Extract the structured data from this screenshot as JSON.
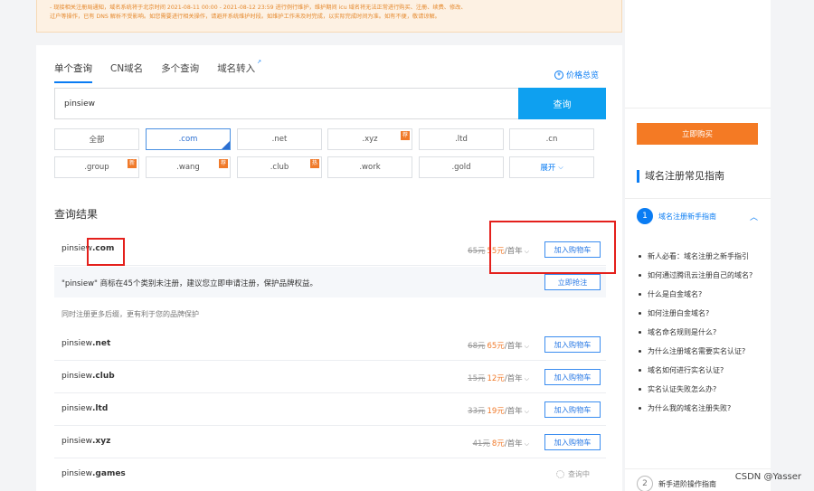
{
  "notice": {
    "line1": "- 现接相关注册局通知，域名系统将于北京时间 2021-08-11 00:00 - 2021-08-12 23:59 进行例行维护，维护期间 icu 域名将无法正常进行购买、注册、续费、修改、",
    "line2": "过户等操作，已有 DNS 解析不受影响。如您需要进行相关操作，请避开系统维护时段。如维护工作未及时完成，以实际完成时间为准。如有不便，敬请谅解。"
  },
  "tabs": [
    {
      "label": "单个查询"
    },
    {
      "label": "CN域名"
    },
    {
      "label": "多个查询"
    },
    {
      "label": "域名转入"
    }
  ],
  "price_overview": "价格总览",
  "search": {
    "value": "pinsiew",
    "button": "查询"
  },
  "tlds": [
    {
      "label": "全部"
    },
    {
      "label": ".com"
    },
    {
      "label": ".net"
    },
    {
      "label": ".xyz",
      "badge": "荐"
    },
    {
      "label": ".ltd"
    },
    {
      "label": ".cn"
    },
    {
      "label": ".group",
      "badge": "新"
    },
    {
      "label": ".wang",
      "badge": "荐"
    },
    {
      "label": ".club",
      "badge": "热"
    },
    {
      "label": ".work"
    },
    {
      "label": ".gold"
    },
    {
      "label": "展开"
    }
  ],
  "results_title": "查询结果",
  "results": [
    {
      "name": "pinsiew",
      "tld": ".com",
      "old_price": "65元",
      "new_price": "55元",
      "unit": "/首年",
      "action": "加入购物车"
    },
    {
      "name": "pinsiew",
      "tld": ".net",
      "old_price": "68元",
      "new_price": "65元",
      "unit": "/首年",
      "action": "加入购物车"
    },
    {
      "name": "pinsiew",
      "tld": ".club",
      "old_price": "15元",
      "new_price": "12元",
      "unit": "/首年",
      "action": "加入购物车"
    },
    {
      "name": "pinsiew",
      "tld": ".ltd",
      "old_price": "33元",
      "new_price": "19元",
      "unit": "/首年",
      "action": "加入购物车"
    },
    {
      "name": "pinsiew",
      "tld": ".xyz",
      "old_price": "41元",
      "new_price": "8元",
      "unit": "/首年",
      "action": "加入购物车"
    },
    {
      "name": "pinsiew",
      "tld": ".games",
      "status": "查询中"
    }
  ],
  "trademark": {
    "text": "\"pinsiew\" 商标在45个类别未注册，建议您立即申请注册，保护品牌权益。",
    "button": "立即抢注"
  },
  "hint": "同时注册更多后缀，更有利于您的品牌保护",
  "sidebar": {
    "buy_button": "立即购买",
    "guide_title": "域名注册常见指南",
    "section1": {
      "num": "1",
      "label": "域名注册新手指南"
    },
    "items": [
      "新人必看：域名注册之新手指引",
      "如何通过腾讯云注册自己的域名?",
      "什么是白金域名?",
      "如何注册白金域名?",
      "域名命名规则是什么?",
      "为什么注册域名需要实名认证?",
      "域名如何进行实名认证?",
      "实名认证失败怎么办?",
      "为什么我的域名注册失败?"
    ],
    "section2": {
      "num": "2",
      "label": "新手进阶操作指南"
    }
  },
  "watermark": "CSDN @Yasser"
}
